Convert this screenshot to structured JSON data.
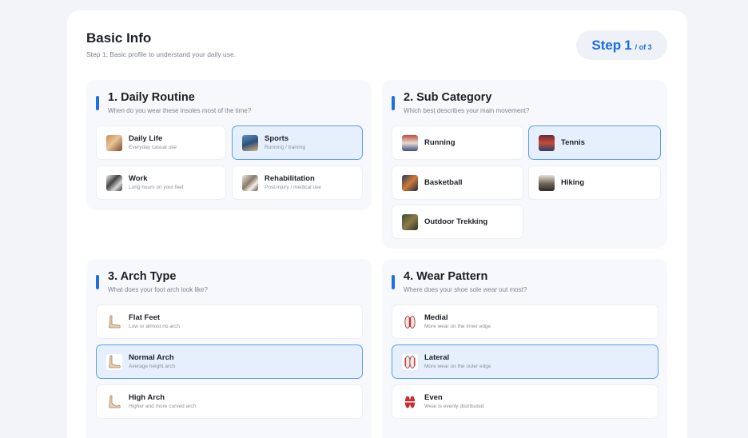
{
  "header": {
    "title": "Basic Info",
    "subtitle": "Step 1: Basic profile to understand your daily use.",
    "step_word": "Step",
    "step_num": "1",
    "step_of": "/ of 3"
  },
  "sections": {
    "daily_routine": {
      "title": "1. Daily Routine",
      "subtitle": "When do you wear these insoles most of the time?",
      "options": [
        {
          "label": "Daily Life",
          "desc": "Everyday casual use",
          "icon": "daily-life-photo"
        },
        {
          "label": "Sports",
          "desc": "Running / training",
          "icon": "sports-photo",
          "selected": true
        },
        {
          "label": "Work",
          "desc": "Long hours on your feet",
          "icon": "work-photo"
        },
        {
          "label": "Rehabilitation",
          "desc": "Post-injury / medical use",
          "icon": "rehabilitation-photo"
        }
      ]
    },
    "sub_category": {
      "title": "2. Sub Category",
      "subtitle": "Which best describes your main movement?",
      "options": [
        {
          "label": "Running",
          "icon": "running-photo"
        },
        {
          "label": "Tennis",
          "icon": "tennis-photo",
          "selected": true
        },
        {
          "label": "Basketball",
          "icon": "basketball-photo"
        },
        {
          "label": "Hiking",
          "icon": "hiking-photo"
        },
        {
          "label": "Outdoor Trekking",
          "icon": "trekking-photo"
        }
      ]
    },
    "arch_type": {
      "title": "3. Arch Type",
      "subtitle": "What does your foot arch look like?",
      "options": [
        {
          "label": "Flat Feet",
          "desc": "Low or almost no arch",
          "icon": "foot-icon"
        },
        {
          "label": "Normal Arch",
          "desc": "Average height arch",
          "icon": "foot-icon",
          "selected": true
        },
        {
          "label": "High Arch",
          "desc": "Higher and more curved arch",
          "icon": "foot-icon"
        }
      ]
    },
    "wear_pattern": {
      "title": "4. Wear Pattern",
      "subtitle": "Where does your shoe sole wear out most?",
      "options": [
        {
          "label": "Medial",
          "desc": "More wear on the inner edge",
          "icon": "sole-icon"
        },
        {
          "label": "Lateral",
          "desc": "More wear on the outer edge",
          "icon": "sole-icon",
          "selected": true
        },
        {
          "label": "Even",
          "desc": "Wear is evenly distributed",
          "icon": "sole-icon"
        }
      ]
    }
  },
  "colors": {
    "accent": "#1a6ee8",
    "selected_bg": "#e6f0fd",
    "selected_border": "#5b9cf0",
    "page_bg": "#f3f4f8",
    "section_bg": "#f7f8fb"
  }
}
